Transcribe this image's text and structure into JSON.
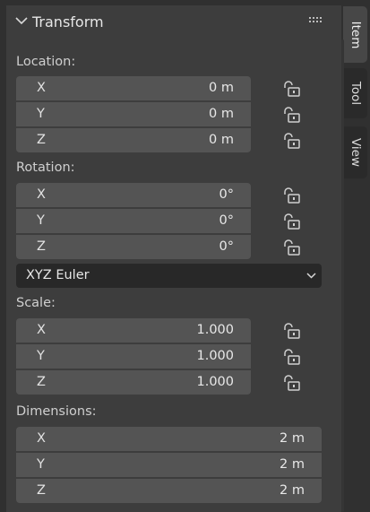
{
  "panel": {
    "title": "Transform",
    "sections": {
      "location": {
        "label": "Location:",
        "fields": [
          {
            "axis": "X",
            "value": "0 m"
          },
          {
            "axis": "Y",
            "value": "0 m"
          },
          {
            "axis": "Z",
            "value": "0 m"
          }
        ]
      },
      "rotation": {
        "label": "Rotation:",
        "fields": [
          {
            "axis": "X",
            "value": "0°"
          },
          {
            "axis": "Y",
            "value": "0°"
          },
          {
            "axis": "Z",
            "value": "0°"
          }
        ],
        "mode": "XYZ Euler"
      },
      "scale": {
        "label": "Scale:",
        "fields": [
          {
            "axis": "X",
            "value": "1.000"
          },
          {
            "axis": "Y",
            "value": "1.000"
          },
          {
            "axis": "Z",
            "value": "1.000"
          }
        ]
      },
      "dimensions": {
        "label": "Dimensions:",
        "fields": [
          {
            "axis": "X",
            "value": "2 m"
          },
          {
            "axis": "Y",
            "value": "2 m"
          },
          {
            "axis": "Z",
            "value": "2 m"
          }
        ]
      }
    }
  },
  "tabs": [
    {
      "label": "Item",
      "active": true
    },
    {
      "label": "Tool",
      "active": false
    },
    {
      "label": "View",
      "active": false
    }
  ],
  "colors": {
    "panel_bg": "#3d3d3d",
    "field_bg": "#545454",
    "dropdown_bg": "#282828",
    "text": "#e6e6e6"
  }
}
